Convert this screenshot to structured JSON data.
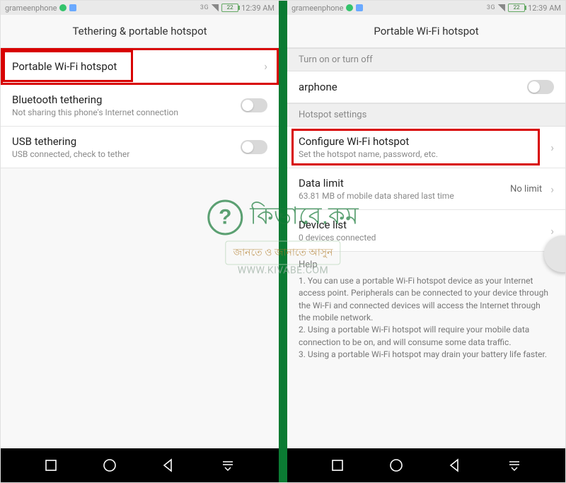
{
  "statusbar": {
    "carrier": "grameenphone",
    "network": "3G",
    "battery": "22",
    "time": "12:39 AM"
  },
  "left": {
    "header": "Tethering & portable hotspot",
    "portable_wifi": "Portable Wi-Fi hotspot",
    "bt_title": "Bluetooth tethering",
    "bt_sub": "Not sharing this phone's Internet connection",
    "usb_title": "USB tethering",
    "usb_sub": "USB connected, check to tether"
  },
  "right": {
    "header": "Portable Wi-Fi hotspot",
    "section_turn": "Turn on or turn off",
    "ap_name": "arphone",
    "section_settings": "Hotspot settings",
    "configure_title": "Configure Wi-Fi hotspot",
    "configure_sub": "Set the hotspot name, password, etc.",
    "datalimit_title": "Data limit",
    "datalimit_sub": "63.81 MB of mobile data shared last time",
    "datalimit_value": "No limit",
    "devlist_title": "Device list",
    "devlist_sub": "0 devices connected",
    "help_title": "Help",
    "help_text": "1. You can use a portable Wi-Fi hotspot device as your Internet access point. Peripherals can be connected to your device through the Wi-Fi and connected devices will access the Internet through the mobile network.\n2. Using a portable Wi-Fi hotspot will require your mobile data connection to be on, and will consume some data traffic.\n3. Using a portable Wi-Fi hotspot may drain your battery life faster."
  },
  "watermark": {
    "brand": "কিভাবে.কম",
    "tagline": "জানতে ও জানাতে আসুন",
    "url": "WWW.KIVABE.COM"
  }
}
